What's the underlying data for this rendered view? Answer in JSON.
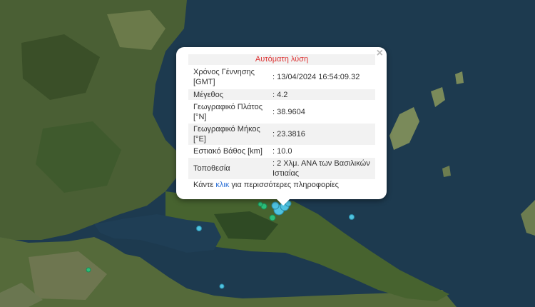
{
  "popup": {
    "title": "Αυτόματη λύση",
    "close_symbol": "×",
    "rows": [
      {
        "label": "Χρόνος Γέννησης [GMT]",
        "value": ": 13/04/2024 16:54:09.32"
      },
      {
        "label": "Μέγεθος",
        "value": ": 4.2"
      },
      {
        "label": "Γεωγραφικό Πλάτος [°N]",
        "value": ": 38.9604"
      },
      {
        "label": "Γεωγραφικό Μήκος [°E]",
        "value": ": 23.3816"
      },
      {
        "label": "Εστιακό Βάθος [km]",
        "value": ": 10.0"
      },
      {
        "label": "Τοποθεσία",
        "value": ": 2 Χλμ. ΑΝΑ των Βασιλικών Ιστιαίας"
      }
    ],
    "footer": {
      "before": "Κάντε ",
      "link": "κλικ",
      "after": " για περισσότερες πληροφορίες"
    }
  },
  "colors": {
    "sea": "#1d3a4f",
    "land": "#3e5a2e",
    "marker_fill": "#4fc3e0",
    "marker_green": "#2bbf7a",
    "title_red": "#d33333",
    "link_blue": "#2a6fd6"
  },
  "icons": [
    "close-icon",
    "earthquake-marker"
  ]
}
